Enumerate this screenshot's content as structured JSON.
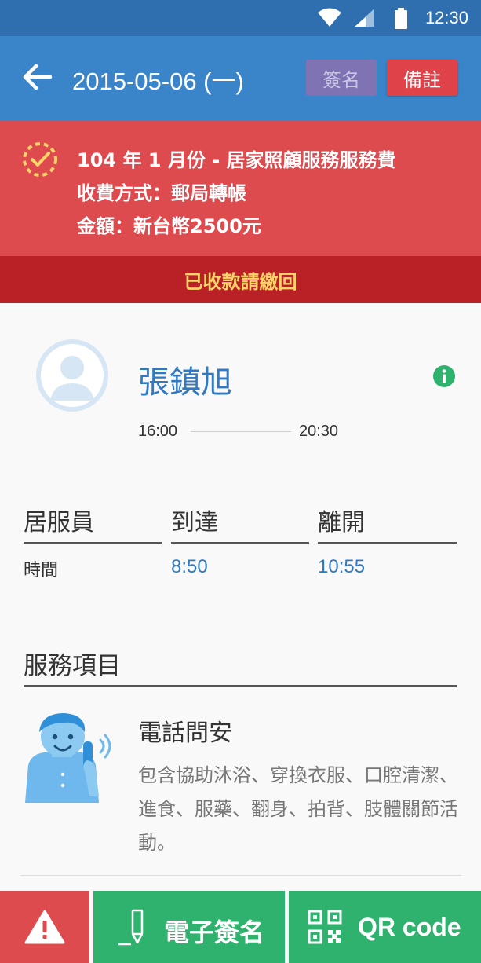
{
  "status_bar": {
    "time": "12:30",
    "icons": [
      "wifi-icon",
      "signal-icon",
      "battery-icon"
    ]
  },
  "app_bar": {
    "date": "2015-05-06 (一)",
    "sign_button": "簽名",
    "note_button": "備註"
  },
  "alert": {
    "line1": "104 年 1 月份 - 居家照顧服務服務費",
    "line2": "收費方式：郵局轉帳",
    "line3": "金額：新台幣2500元",
    "paid_notice": "已收款請繳回"
  },
  "client": {
    "name": "張鎮旭",
    "start_time": "16:00",
    "end_time": "20:30"
  },
  "attendance": {
    "headers": [
      "居服員",
      "到達",
      "離開"
    ],
    "row_label": "時間",
    "arrive": "8:50",
    "leave": "10:55"
  },
  "service": {
    "section_title": "服務項目",
    "item_title": "電話問安",
    "item_desc": "包含協助沐浴、穿換衣服、口腔清潔、進食、服藥、翻身、拍背、肢體關節活動。"
  },
  "bottom_bar": {
    "esign_label": "電子簽名",
    "qr_label": "QR code"
  },
  "colors": {
    "app_bar": "#3a84c9",
    "alert": "#dd4b4f",
    "paid_bar": "#b92126",
    "paid_text": "#ffd36a",
    "accent_blue": "#2f7ac4",
    "green": "#2fb26d"
  }
}
